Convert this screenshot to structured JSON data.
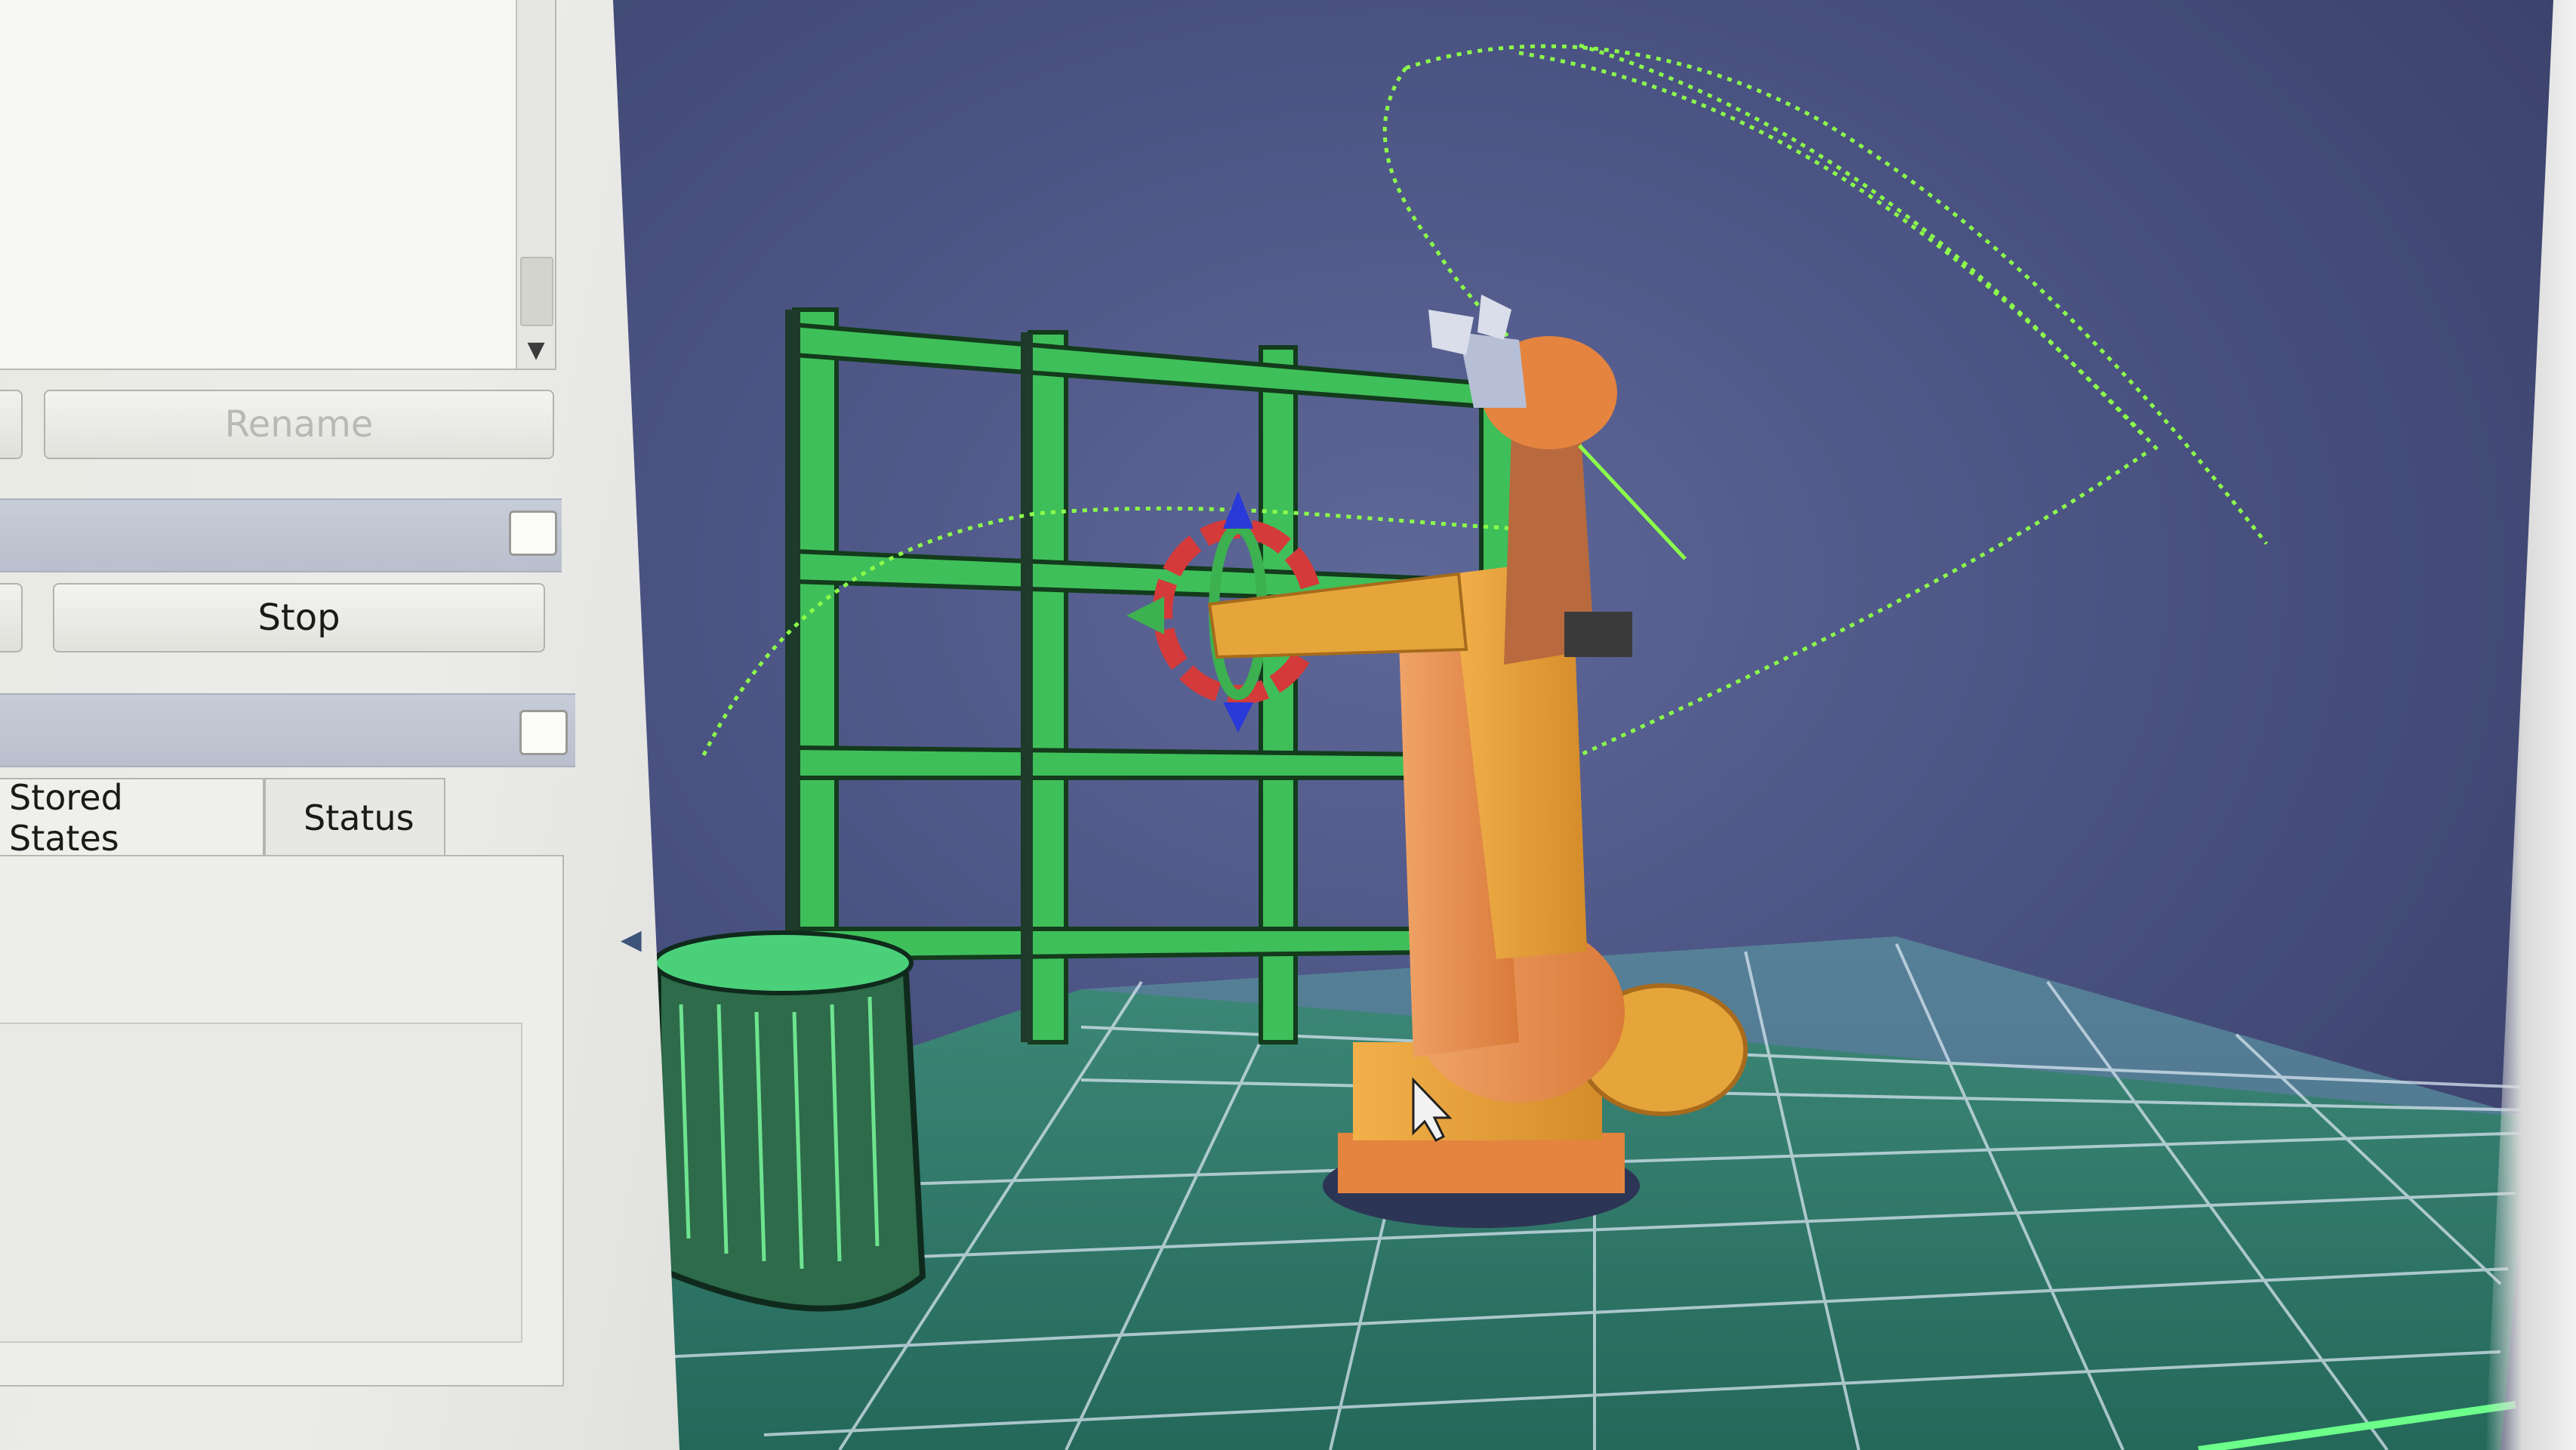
{
  "panel": {
    "rename_label": "Rename",
    "stop_label": "Stop",
    "tabs": [
      {
        "label": "Stored States"
      },
      {
        "label": "Status"
      }
    ]
  },
  "colors": {
    "robot_orange": "#e8914e",
    "robot_yellow": "#e6a53a",
    "collision_green": "#3fbf5a",
    "trajectory_green": "#8cff4a",
    "floor_teal": "#2f7a6a"
  },
  "icons": {
    "scroll_down": "▼",
    "collapse": "◀"
  }
}
